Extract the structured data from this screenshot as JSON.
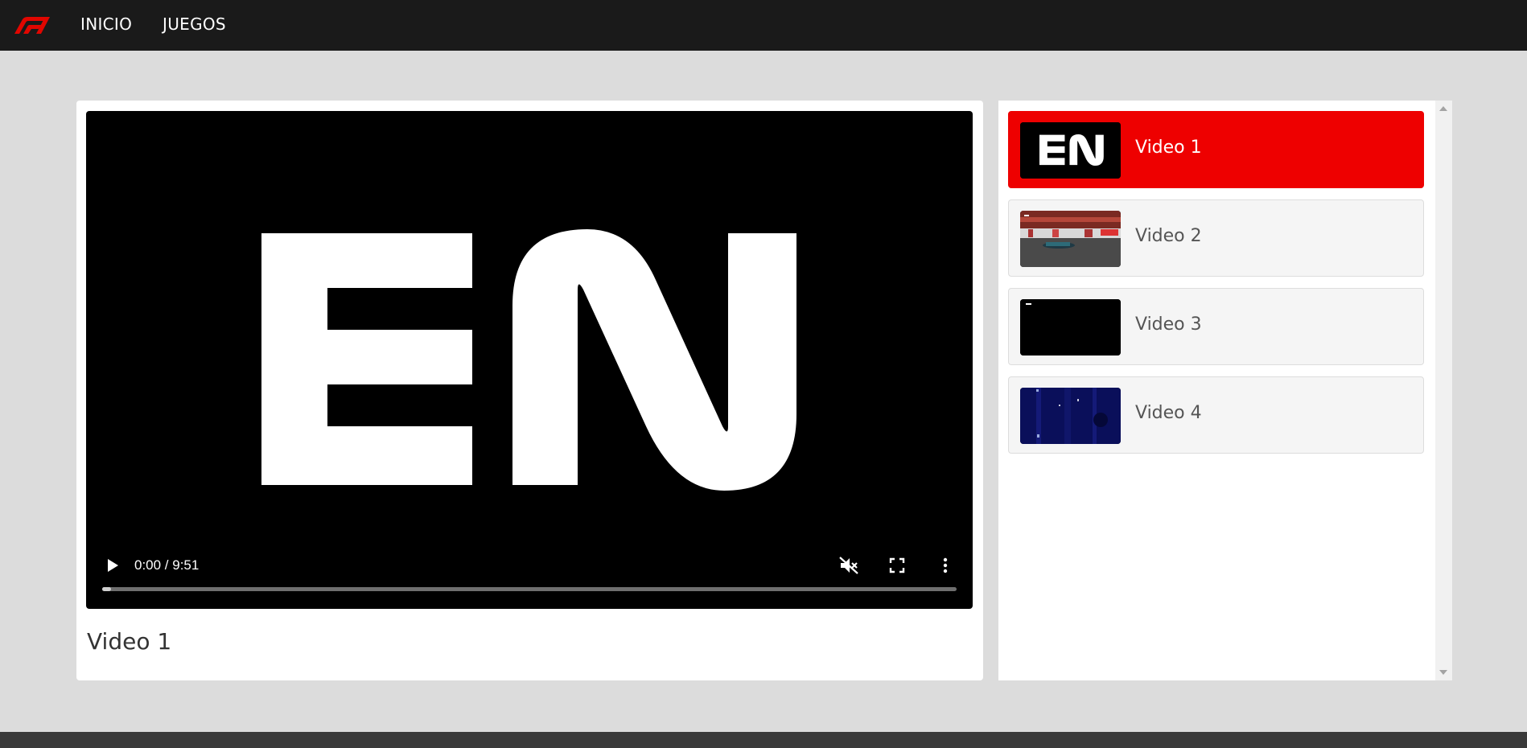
{
  "nav": {
    "links": [
      {
        "label": "INICIO"
      },
      {
        "label": "JUEGOS"
      }
    ]
  },
  "player": {
    "logo_text": "EN",
    "time": "0:00 / 9:51",
    "progress": 0.01,
    "icons": [
      "play-icon",
      "volume-muted-icon",
      "fullscreen-icon",
      "more-vert-icon"
    ]
  },
  "current_video": {
    "title": "Video 1"
  },
  "playlist": {
    "items": [
      {
        "label": "Video 1",
        "active": true,
        "thumb": "en-logo-thumbnail"
      },
      {
        "label": "Video 2",
        "active": false,
        "thumb": "race-car-thumbnail"
      },
      {
        "label": "Video 3",
        "active": false,
        "thumb": "black-thumbnail"
      },
      {
        "label": "Video 4",
        "active": false,
        "thumb": "dark-blue-thumbnail"
      }
    ]
  },
  "colors": {
    "header": "#1a1a1a",
    "accent": "#ee0000",
    "background": "#dcdcdc"
  }
}
